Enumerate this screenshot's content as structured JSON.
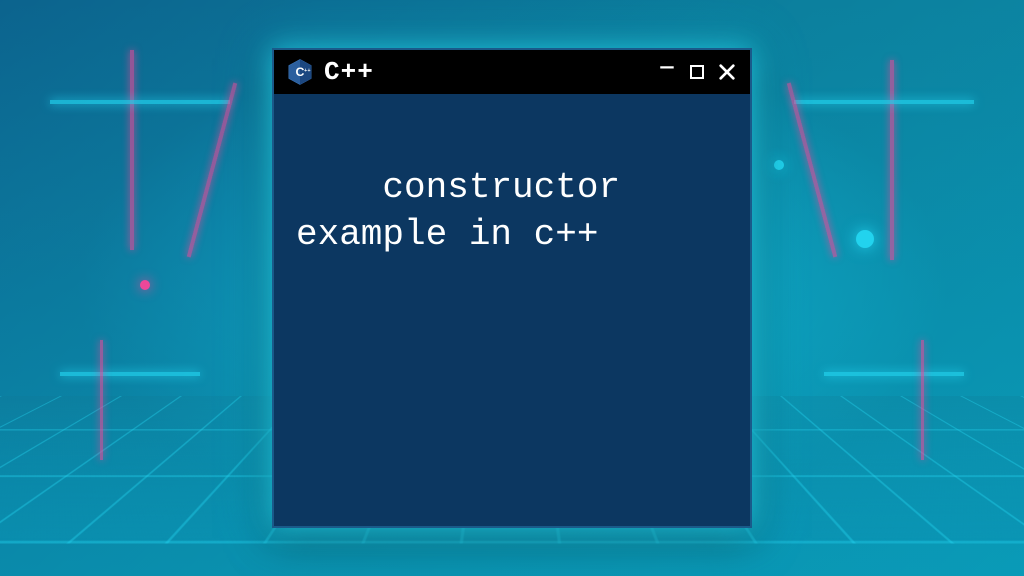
{
  "window": {
    "title": "C++",
    "logo_alt": "cpp-icon"
  },
  "content": {
    "text": "constructor example in c++"
  }
}
